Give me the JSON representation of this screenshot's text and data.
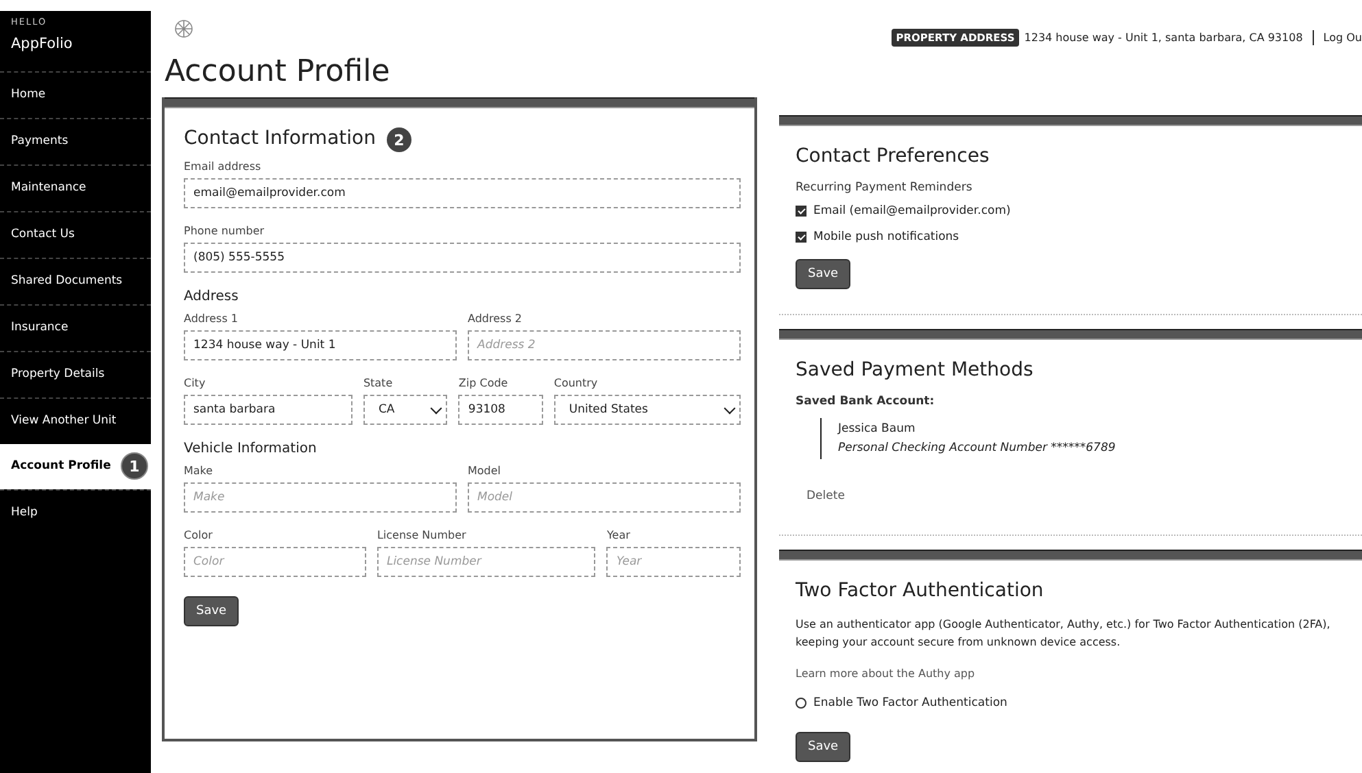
{
  "sidebar": {
    "greeting": "HELLO",
    "brand": "AppFolio",
    "items": [
      {
        "label": "Home",
        "selected": false
      },
      {
        "label": "Payments",
        "selected": false
      },
      {
        "label": "Maintenance",
        "selected": false
      },
      {
        "label": "Contact Us",
        "selected": false
      },
      {
        "label": "Shared Documents",
        "selected": false
      },
      {
        "label": "Insurance",
        "selected": false
      },
      {
        "label": "Property Details",
        "selected": false
      },
      {
        "label": "View Another Unit",
        "selected": false
      },
      {
        "label": "Account Profile",
        "selected": true,
        "callout": "1"
      },
      {
        "label": "Help",
        "selected": false
      }
    ]
  },
  "header": {
    "badge": "PROPERTY ADDRESS",
    "address": "1234 house way - Unit 1, santa barbara, CA 93108",
    "logout": "Log Ou"
  },
  "page_title": "Account Profile",
  "contact_information": {
    "title": "Contact Information",
    "callout": "2",
    "blocks": [
      {
        "kind": "row",
        "fields": [
          {
            "label": "Email address",
            "value": "email@emailprovider.com",
            "kind": "text"
          }
        ]
      },
      {
        "kind": "row",
        "fields": [
          {
            "label": "Phone number",
            "value": "(805) 555-5555",
            "kind": "text"
          }
        ]
      },
      {
        "kind": "heading",
        "text": "Address"
      },
      {
        "kind": "row",
        "fields": [
          {
            "label": "Address 1",
            "value": "1234 house way - Unit 1",
            "kind": "text"
          },
          {
            "label": "Address 2",
            "placeholder": "Address 2",
            "kind": "text"
          }
        ]
      },
      {
        "kind": "row",
        "fields": [
          {
            "label": "City",
            "value": "santa barbara",
            "kind": "text"
          },
          {
            "label": "State",
            "value": "CA",
            "kind": "select"
          },
          {
            "label": "Zip Code",
            "value": "93108",
            "kind": "text"
          },
          {
            "label": "Country",
            "value": "United States",
            "kind": "select"
          }
        ]
      },
      {
        "kind": "heading",
        "text": "Vehicle Information"
      },
      {
        "kind": "row",
        "fields": [
          {
            "label": "Make",
            "placeholder": "Make",
            "kind": "text"
          },
          {
            "label": "Model",
            "placeholder": "Model",
            "kind": "text"
          }
        ]
      },
      {
        "kind": "row",
        "fields": [
          {
            "label": "Color",
            "placeholder": "Color",
            "kind": "text"
          },
          {
            "label": "License Number",
            "placeholder": "License Number",
            "kind": "text"
          },
          {
            "label": "Year",
            "placeholder": "Year",
            "kind": "text"
          }
        ]
      },
      {
        "kind": "button",
        "text": "Save"
      }
    ]
  },
  "contact_preferences": {
    "title": "Contact Preferences",
    "subtitle": "Recurring Payment Reminders",
    "options": [
      {
        "label": "Email (email@emailprovider.com)",
        "checked": true,
        "kind": "checkbox"
      },
      {
        "label": "Mobile push notifications",
        "checked": true,
        "kind": "checkbox"
      }
    ],
    "button": "Save"
  },
  "saved_payment_methods": {
    "title": "Saved Payment Methods",
    "subtitle": "Saved Bank Account:",
    "account_name": "Jessica Baum",
    "account_description": "Personal Checking Account Number ******6789",
    "delete": "Delete"
  },
  "two_factor_authentication": {
    "title": "Two Factor Authentication",
    "description": "Use an authenticator app (Google Authenticator, Authy, etc.) for Two Factor Authentication (2FA), keeping your account secure from unknown device access.",
    "link": "Learn more about the Authy app",
    "options": [
      {
        "label": "Enable Two Factor Authentication",
        "checked": false,
        "kind": "radio"
      }
    ],
    "button": "Save"
  }
}
